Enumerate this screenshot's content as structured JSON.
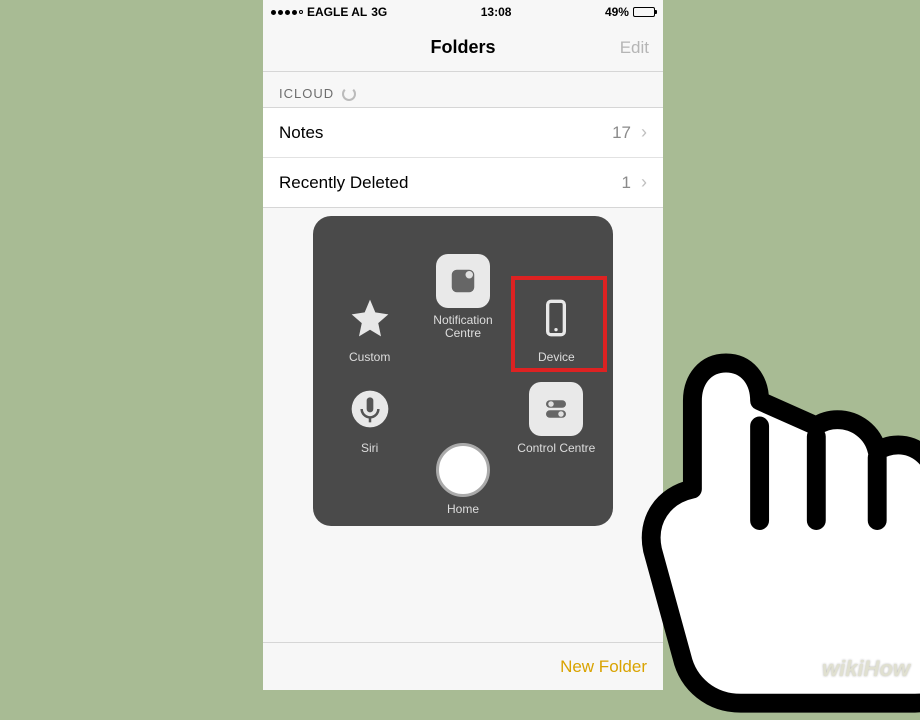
{
  "status": {
    "carrier": "EAGLE AL",
    "network": "3G",
    "time": "13:08",
    "battery_pct": "49%"
  },
  "nav": {
    "title": "Folders",
    "edit": "Edit"
  },
  "section": {
    "icloud": "ICLOUD"
  },
  "rows": {
    "notes": {
      "label": "Notes",
      "count": "17"
    },
    "recently_deleted": {
      "label": "Recently Deleted",
      "count": "1"
    }
  },
  "assistive_touch": {
    "notification": "Notification Centre",
    "custom": "Custom",
    "device": "Device",
    "siri": "Siri",
    "home": "Home",
    "control_centre": "Control Centre"
  },
  "toolbar": {
    "new_folder": "New Folder"
  },
  "watermark": "wikiHow"
}
